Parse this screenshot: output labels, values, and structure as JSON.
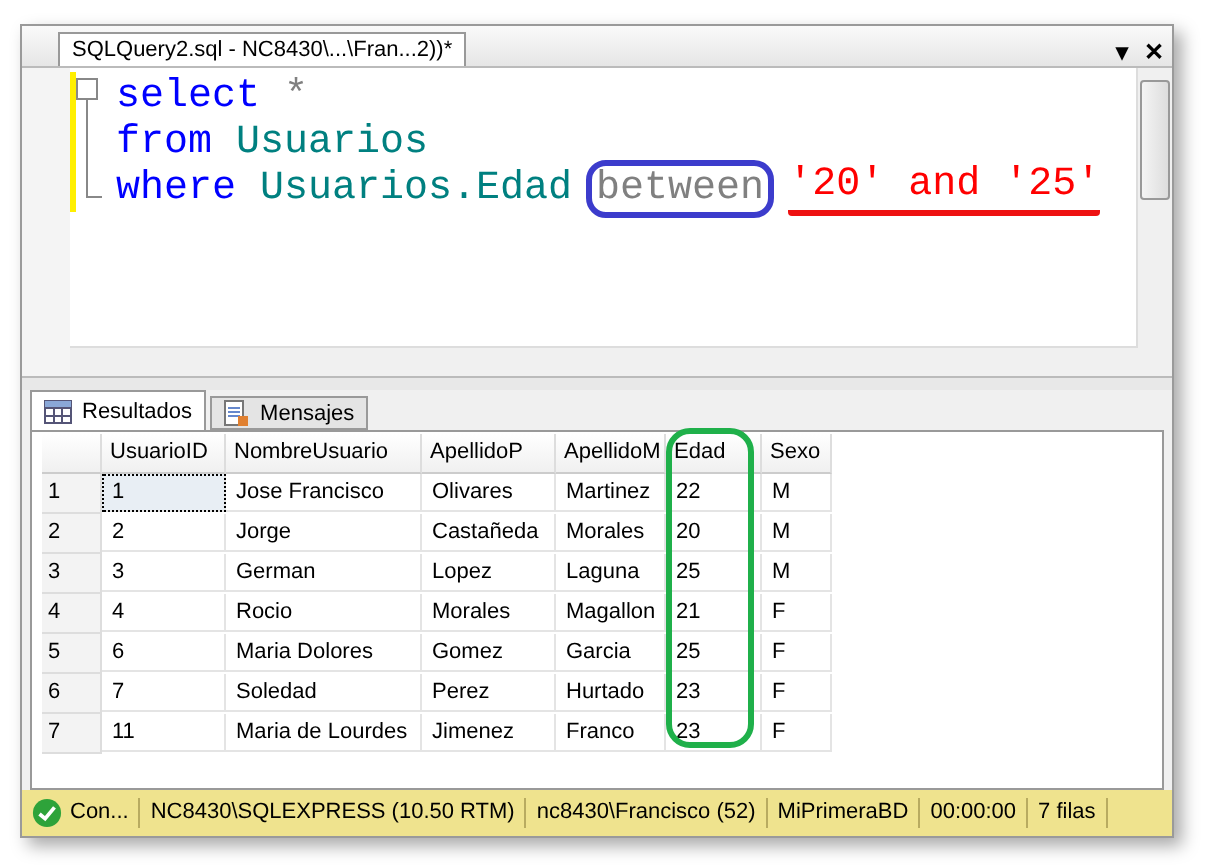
{
  "document_tab": {
    "title": "SQLQuery2.sql - NC8430\\...\\Fran...2))*",
    "buttons": [
      "▾",
      "✕"
    ]
  },
  "editor": {
    "lines": [
      {
        "tokens": [
          {
            "text": "select",
            "kind": "keyword"
          },
          {
            "text": "*",
            "kind": "operator"
          }
        ]
      },
      {
        "tokens": [
          {
            "text": "from",
            "kind": "keyword"
          },
          {
            "text": "Usuarios",
            "kind": "identifier"
          }
        ]
      },
      {
        "tokens": [
          {
            "text": "where",
            "kind": "keyword"
          },
          {
            "text": "Usuarios.Edad",
            "kind": "identifier"
          },
          {
            "text": "between",
            "kind": "operator",
            "circled": true,
            "underlined": false
          },
          {
            "text": "'20' and '25'",
            "kind": "string",
            "circled": false,
            "underlined": true
          }
        ]
      }
    ]
  },
  "result_tabs": [
    {
      "label": "Resultados",
      "selected": true,
      "kind": "grid"
    },
    {
      "label": "Mensajes",
      "selected": false,
      "kind": "document"
    }
  ],
  "grid": {
    "columns": [
      {
        "label": "UsuarioID",
        "marked": false
      },
      {
        "label": "NombreUsuario",
        "marked": false
      },
      {
        "label": "ApellidoP",
        "marked": false
      },
      {
        "label": "ApellidoM",
        "marked": false
      },
      {
        "label": "Edad",
        "marked": true
      },
      {
        "label": "Sexo",
        "marked": false
      }
    ],
    "rows": [
      {
        "number": "1",
        "cells": [
          "1",
          "Jose Francisco",
          "Olivares",
          "Martinez",
          "22",
          "M"
        ],
        "selected": true
      },
      {
        "number": "2",
        "cells": [
          "2",
          "Jorge",
          "Castañeda",
          "Morales",
          "20",
          "M"
        ],
        "selected": false
      },
      {
        "number": "3",
        "cells": [
          "3",
          "German",
          "Lopez",
          "Laguna",
          "25",
          "M"
        ],
        "selected": false
      },
      {
        "number": "4",
        "cells": [
          "4",
          "Rocio",
          "Morales",
          "Magallon",
          "21",
          "F"
        ],
        "selected": false
      },
      {
        "number": "5",
        "cells": [
          "6",
          "Maria Dolores",
          "Gomez",
          "Garcia",
          "25",
          "F"
        ],
        "selected": false
      },
      {
        "number": "6",
        "cells": [
          "7",
          "Soledad",
          "Perez",
          "Hurtado",
          "23",
          "F"
        ],
        "selected": false
      },
      {
        "number": "7",
        "cells": [
          "11",
          "Maria de Lourdes",
          "Jimenez",
          "Franco",
          "23",
          "F"
        ],
        "selected": false
      }
    ]
  },
  "status_bar": [
    "Con...",
    "NC8430\\SQLEXPRESS (10.50 RTM)",
    "nc8430\\Francisco (52)",
    "MiPrimeraBD",
    "00:00:00",
    "7 filas"
  ]
}
